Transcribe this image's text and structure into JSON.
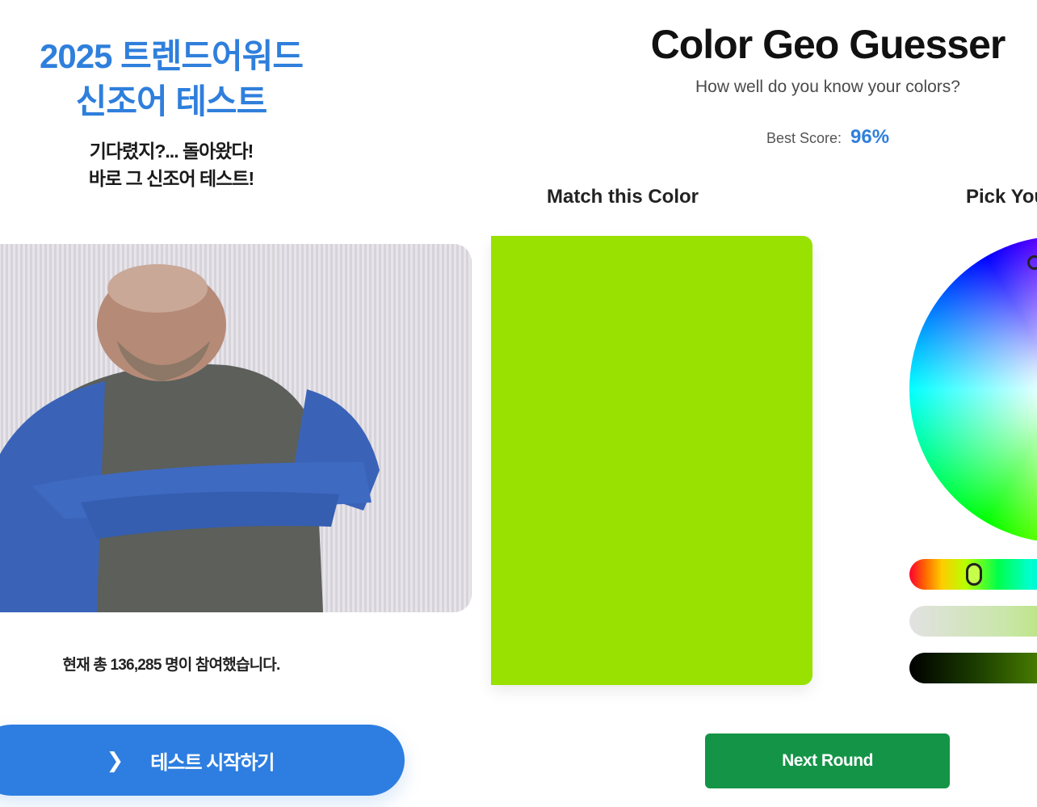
{
  "quiz_ad": {
    "title_line1": "2025 트렌드어워드",
    "title_line2": "신조어 테스트",
    "sub_line1": "기다렸지?... 돌아왔다!",
    "sub_line2": "바로 그 신조어 테스트!",
    "participants": "현재 총 136,285 명이 참여했습니다.",
    "start_button": "테스트 시작하기",
    "start_icon": "chevron-right-icon",
    "accent_color": "#2f7fdc"
  },
  "game": {
    "title": "Color Geo Guesser",
    "subtitle": "How well do you know your colors?",
    "best_score_label": "Best Score:",
    "best_score_value": "96%",
    "match_label": "Match this Color",
    "pick_label": "Pick You",
    "target_color": "#98e100",
    "next_button": "Next Round",
    "next_button_color": "#149447"
  }
}
